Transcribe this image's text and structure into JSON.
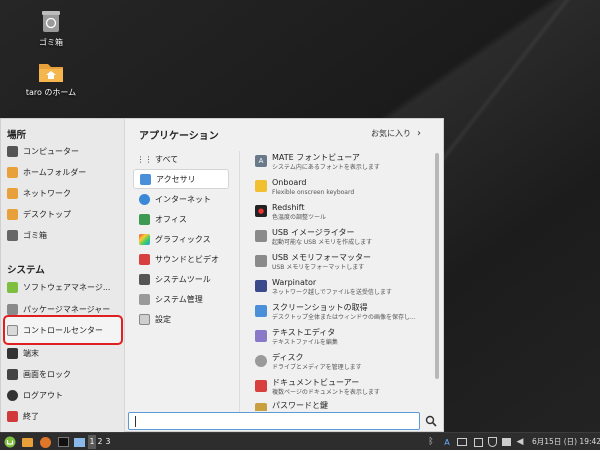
{
  "desktop": {
    "icons": [
      {
        "label": "ゴミ箱",
        "icon": "trash-icon"
      },
      {
        "label": "taro のホーム",
        "icon": "home-folder-icon"
      }
    ]
  },
  "menu": {
    "places": {
      "title": "場所",
      "items": [
        {
          "label": "コンピューター",
          "icon": "computer-icon"
        },
        {
          "label": "ホームフォルダー",
          "icon": "home-folder-icon"
        },
        {
          "label": "ネットワーク",
          "icon": "network-icon"
        },
        {
          "label": "デスクトップ",
          "icon": "desktop-folder-icon"
        },
        {
          "label": "ゴミ箱",
          "icon": "trash-icon"
        }
      ]
    },
    "system": {
      "title": "システム",
      "items": [
        {
          "label": "ソフトウェアマネージ...",
          "icon": "software-manager-icon"
        },
        {
          "label": "パッケージマネージャー",
          "icon": "package-manager-icon"
        },
        {
          "label": "コントロールセンター",
          "icon": "control-center-icon"
        },
        {
          "label": "端末",
          "icon": "terminal-icon"
        },
        {
          "label": "画面をロック",
          "icon": "lock-screen-icon"
        },
        {
          "label": "ログアウト",
          "icon": "logout-icon"
        },
        {
          "label": "終了",
          "icon": "power-icon"
        }
      ]
    },
    "applications_title": "アプリケーション",
    "favorites_label": "お気に入り",
    "categories": [
      {
        "label": "すべて",
        "icon": "grid-icon"
      },
      {
        "label": "アクセサリ",
        "icon": "accessories-icon"
      },
      {
        "label": "インターネット",
        "icon": "internet-icon"
      },
      {
        "label": "オフィス",
        "icon": "office-icon"
      },
      {
        "label": "グラフィックス",
        "icon": "graphics-icon"
      },
      {
        "label": "サウンドとビデオ",
        "icon": "sound-video-icon"
      },
      {
        "label": "システムツール",
        "icon": "system-tools-icon"
      },
      {
        "label": "システム管理",
        "icon": "administration-icon"
      },
      {
        "label": "設定",
        "icon": "settings-icon"
      }
    ],
    "selected_category": "アクセサリ",
    "apps": [
      {
        "name": "MATE フォントビューア",
        "desc": "システム内にあるフォントを表示します",
        "icon": "font-viewer-icon"
      },
      {
        "name": "Onboard",
        "desc": "Flexible onscreen keyboard",
        "icon": "onboard-keyboard-icon"
      },
      {
        "name": "Redshift",
        "desc": "色温度の調整ツール",
        "icon": "redshift-icon"
      },
      {
        "name": "USB イメージライター",
        "desc": "起動可能な USB メモリを作成します",
        "icon": "usb-image-writer-icon"
      },
      {
        "name": "USB メモリフォーマッター",
        "desc": "USB メモリをフォーマットします",
        "icon": "usb-formatter-icon"
      },
      {
        "name": "Warpinator",
        "desc": "ネットワーク越しでファイルを送受信します",
        "icon": "warpinator-icon"
      },
      {
        "name": "スクリーンショットの取得",
        "desc": "デスクトップ全体またはウィンドウの画像を保存し...",
        "icon": "screenshot-icon"
      },
      {
        "name": "テキストエディタ",
        "desc": "テキストファイルを編集",
        "icon": "text-editor-icon"
      },
      {
        "name": "ディスク",
        "desc": "ドライブとメディアを管理します",
        "icon": "disks-icon"
      },
      {
        "name": "ドキュメントビューアー",
        "desc": "複数ページのドキュメントを表示します",
        "icon": "document-viewer-icon"
      },
      {
        "name": "パスワードと鍵",
        "desc": "",
        "icon": "passwords-keys-icon"
      }
    ],
    "search": {
      "value": "",
      "placeholder": ""
    }
  },
  "taskbar": {
    "workspaces": [
      "1",
      "2",
      "3"
    ],
    "clock": "6月15日 (日) 19:42",
    "tray_indicator": "A"
  },
  "colors": {
    "highlight": "#e02020",
    "selection_border": "#5a9bd8",
    "mint_green": "#7fbf3f"
  }
}
